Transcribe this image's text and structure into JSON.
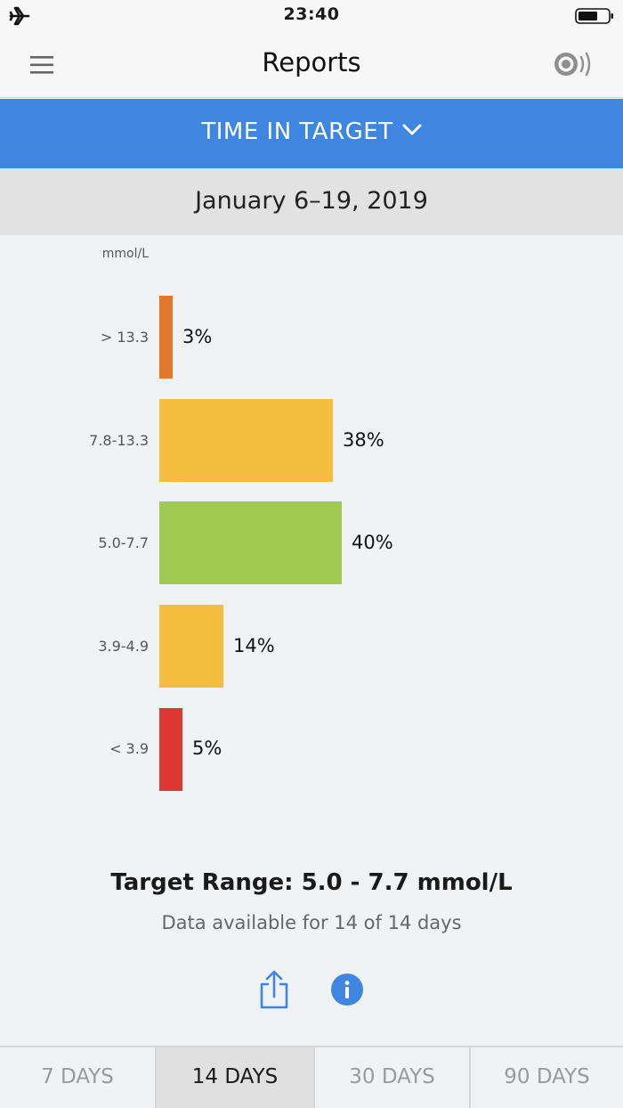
{
  "status_bar": {
    "time": "23:40"
  },
  "nav": {
    "title": "Reports"
  },
  "report_selector": {
    "label": "TIME IN TARGET"
  },
  "date_range": "January 6–19, 2019",
  "chart_data": {
    "type": "bar",
    "orientation": "horizontal",
    "unit": "mmol/L",
    "categories": [
      "> 13.3",
      "7.8-13.3",
      "5.0-7.7",
      "3.9-4.9",
      "< 3.9"
    ],
    "values": [
      3,
      38,
      40,
      14,
      5
    ],
    "value_labels": [
      "3%",
      "38%",
      "40%",
      "14%",
      "5%"
    ],
    "colors": [
      "#e5772c",
      "#f4bd3e",
      "#a0cb53",
      "#f4bd3e",
      "#dc3731"
    ]
  },
  "summary": {
    "target_range": "Target Range: 5.0 - 7.7 mmol/L",
    "availability": "Data available for 14 of 14 days"
  },
  "tabs": [
    {
      "label": "7 DAYS",
      "active": false
    },
    {
      "label": "14 DAYS",
      "active": true
    },
    {
      "label": "30 DAYS",
      "active": false
    },
    {
      "label": "90 DAYS",
      "active": false
    }
  ],
  "colors": {
    "accent": "#3f86e0"
  }
}
